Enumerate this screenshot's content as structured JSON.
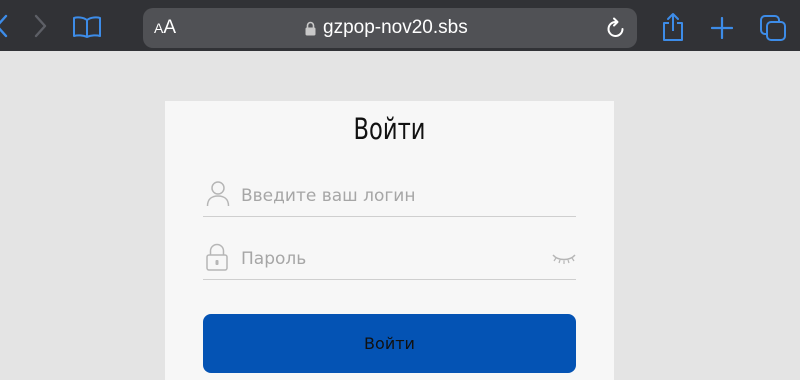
{
  "browser": {
    "text_size_label_small": "A",
    "text_size_label_large": "A",
    "url": "gzpop-nov20.sbs",
    "toolbar_color": "#313236",
    "address_bar_color": "#505155",
    "icon_color": "#3d8ce8"
  },
  "login_form": {
    "title": "Войти",
    "login_placeholder": "Введите ваш логин",
    "login_value": "",
    "password_placeholder": "Пароль",
    "password_value": "",
    "submit_label": "Войти",
    "button_color": "#0453b4"
  },
  "icons": {
    "back": "chevron-left-icon",
    "forward": "chevron-right-icon",
    "bookmarks": "book-icon",
    "lock": "lock-icon",
    "reload": "reload-icon",
    "share": "share-icon",
    "new_tab": "plus-icon",
    "tabs": "tabs-icon",
    "user": "user-icon",
    "password_lock": "padlock-icon",
    "toggle_password": "eye-closed-icon"
  }
}
